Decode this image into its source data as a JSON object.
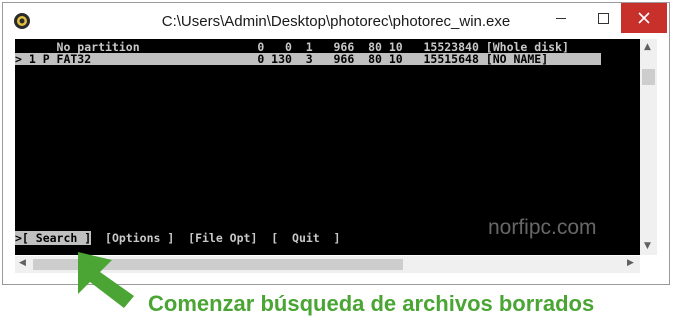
{
  "window": {
    "title": "C:\\Users\\Admin\\Desktop\\photorec\\photorec_win.exe",
    "close_color": "#c7302b"
  },
  "console": {
    "lines": [
      "      No partition                 0   0  1   966  80 10   15523840 [Whole disk]",
      "> 1 P FAT32                        0 130  3   966  80 10   15515648 [NO NAME]"
    ],
    "menu": {
      "search": ">[ Search ]",
      "options": "[Options ]",
      "file_opt": "[File Opt]",
      "quit": "[  Quit  ]"
    }
  },
  "watermark": "norfipc.com",
  "caption": "Comenzar búsqueda de archivos borrados",
  "colors": {
    "caption": "#4aa534",
    "console_bg": "#000000",
    "highlight": "#c0c0c0"
  },
  "icons": [
    "photorec-app-icon",
    "minimize-icon",
    "maximize-icon",
    "close-icon",
    "green-arrow-pointer-icon"
  ]
}
